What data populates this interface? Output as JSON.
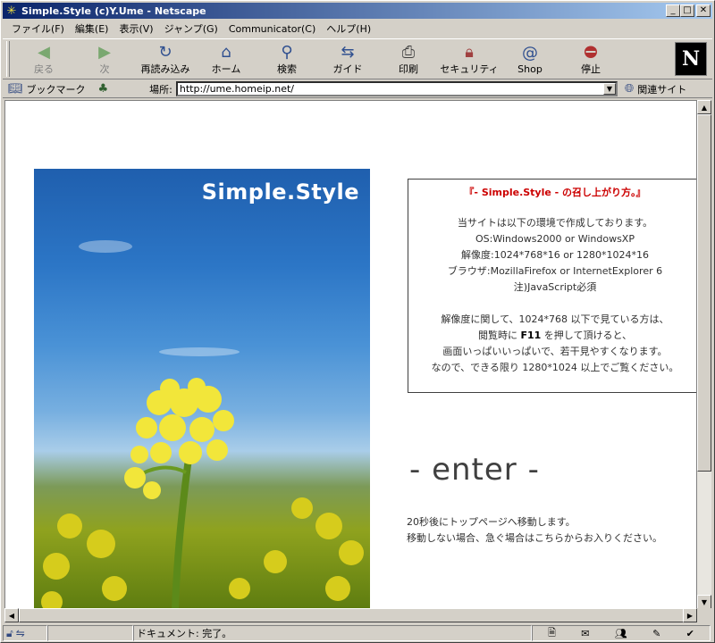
{
  "window": {
    "title": "Simple.Style (c)Y.Ume - Netscape"
  },
  "menu": [
    "ファイル(F)",
    "編集(E)",
    "表示(V)",
    "ジャンプ(G)",
    "Communicator(C)",
    "ヘルプ(H)"
  ],
  "toolbar": {
    "back": "戻る",
    "forward": "次",
    "reload": "再読み込み",
    "home": "ホーム",
    "search": "検索",
    "guide": "ガイド",
    "print": "印刷",
    "security": "セキュリティ",
    "shop": "Shop",
    "stop": "停止",
    "logo": "N"
  },
  "location": {
    "bookmarks": "ブックマーク",
    "label": "場所:",
    "url": "http://ume.homeip.net/",
    "related": "関連サイト"
  },
  "page": {
    "hero_title": "Simple.Style",
    "info": {
      "title": "『- Simple.Style - の召し上がり方。』",
      "line1": "当サイトは以下の環境で作成しております。",
      "line2": "OS:Windows2000 or WindowsXP",
      "line3": "解像度:1024*768*16 or 1280*1024*16",
      "line4": "ブラウザ:MozillaFirefox or InternetExplorer 6",
      "line5": "注)JavaScript必須",
      "line6": "解像度に関して、1024*768 以下で見ている方は、",
      "line7a": "閲覧時に ",
      "line7key": "F11",
      "line7b": " を押して頂けると、",
      "line8": "画面いっぱいいっぱいで、若干見やすくなります。",
      "line9": "なので、できる限り 1280*1024 以上でご覧ください。"
    },
    "enter": "- enter -",
    "redirect_line1": "20秒後にトップページへ移動します。",
    "redirect_line2": "移動しない場合、急ぐ場合はこちらからお入りください。"
  },
  "status": {
    "text": "ドキュメント: 完了。"
  }
}
